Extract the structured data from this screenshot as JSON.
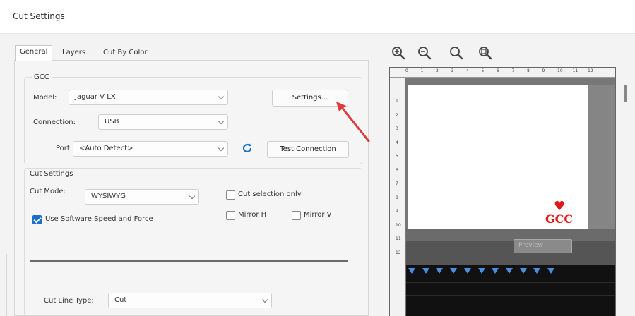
{
  "window": {
    "title": "Cut Settings"
  },
  "tabs": [
    {
      "label": "General"
    },
    {
      "label": "Layers"
    },
    {
      "label": "Cut By Color"
    }
  ],
  "gcc": {
    "group_label": "GCC",
    "model_label": "Model:",
    "model_value": "Jaguar V LX",
    "settings_button": "Settings...",
    "connection_label": "Connection:",
    "connection_value": "USB",
    "port_label": "Port:",
    "port_value": "<Auto Detect>",
    "test_connection_button": "Test Connection"
  },
  "cut_settings": {
    "group_label": "Cut Settings",
    "cut_mode_label": "Cut Mode:",
    "cut_mode_value": "WYSIWYG",
    "cut_selection_only": "Cut selection only",
    "mirror_h": "Mirror H",
    "mirror_v": "Mirror V",
    "use_software_speed": "Use Software Speed and Force",
    "use_software_speed_checked": true,
    "cut_line_type_label": "Cut Line Type:",
    "cut_line_type_value": "Cut"
  },
  "preview": {
    "ruler_x": [
      "0",
      "1",
      "2",
      "3",
      "4",
      "5",
      "6",
      "7",
      "8",
      "9",
      "10",
      "11",
      "12"
    ],
    "ruler_y": [
      "1",
      "2",
      "3",
      "4",
      "5",
      "6",
      "7",
      "8",
      "9",
      "10",
      "11",
      "12"
    ],
    "logo_text": "GCC",
    "logo_heart": "♥",
    "hidden_button": "Preview"
  },
  "icons": {
    "zoom": [
      "zoom-in-icon",
      "zoom-out-icon",
      "zoom-fit-icon",
      "zoom-actual-icon"
    ],
    "refresh": "refresh-icon",
    "arrow": "red-arrow-annotation"
  },
  "colors": {
    "accent": "#1a6fc9",
    "annotation_red": "#e01818",
    "marker_blue": "#4a90e2"
  }
}
